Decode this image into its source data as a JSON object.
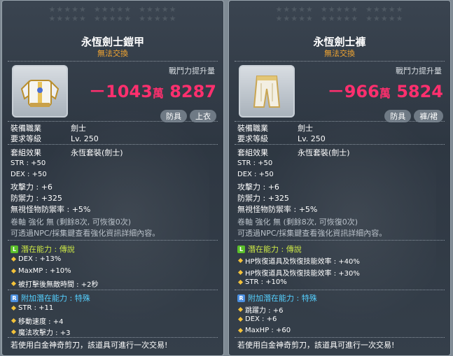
{
  "left": {
    "stars": [
      "★★★★★",
      "★★★★★",
      "★★★★★",
      "★★★★★",
      "★★★★★",
      "★★★★★"
    ],
    "title": "永恆劍士鎧甲",
    "trade": "無法交換",
    "cp_label": "戰鬥力提升量",
    "cp_main": "－1043",
    "cp_man": "萬",
    "cp_tail": "8287",
    "tags": [
      "防具",
      "上衣"
    ],
    "job_label": "裝備職業",
    "job_value": "劍士",
    "lvl_label": "要求等級",
    "lvl_value": "Lv. 250",
    "set_label": "套組效果",
    "set_value": "永恆套裝(劍士)",
    "stats": [
      "STR : +50",
      "DEX : +50",
      "攻擊力 : +6",
      "防禦力 : +325",
      "無視怪物防禦率 : +5%"
    ],
    "scroll_line": "卷軸 強化 無 (剩餘8次, 可恢復0次)",
    "npc_line": "可透過NPC/採集鍵查看強化資訊詳細內容。",
    "potential_title": "潛在能力 : 傳說",
    "potential": [
      "DEX : +13%",
      "MaxMP : +10%",
      "被打擊後無敵時間 : +2秒"
    ],
    "add_title": "附加潛在能力 : 特殊",
    "add_potential": [
      "STR : +11",
      "移動速度 : +4",
      "魔法攻擊力 : +3"
    ],
    "footer": "若使用白金神奇剪刀，該道具可進行一次交易!"
  },
  "right": {
    "stars": [
      "★★★★★",
      "★★★★★",
      "★★★★★",
      "★★★★★",
      "★★★★★",
      "★★★★★"
    ],
    "title": "永恆劍士褲",
    "trade": "無法交換",
    "cp_label": "戰鬥力提升量",
    "cp_main": "－966",
    "cp_man": "萬",
    "cp_tail": "5824",
    "tags": [
      "防具",
      "褲/裙"
    ],
    "job_label": "裝備職業",
    "job_value": "劍士",
    "lvl_label": "要求等級",
    "lvl_value": "Lv. 250",
    "set_label": "套組效果",
    "set_value": "永恆套裝(劍士)",
    "stats": [
      "STR : +50",
      "DEX : +50",
      "攻擊力 : +6",
      "防禦力 : +325",
      "無視怪物防禦率 : +5%"
    ],
    "scroll_line": "卷軸 強化 無 (剩餘8次, 可恢復0次)",
    "npc_line": "可透過NPC/採集鍵查看強化資訊詳細內容。",
    "potential_title": "潛在能力 : 傳說",
    "potential": [
      "HP恢復道具及恢復技能效率 : +40%",
      "HP恢復道具及恢復技能效率 : +30%",
      "STR : +10%"
    ],
    "add_title": "附加潛在能力 : 特殊",
    "add_potential": [
      "跳躍力 : +6",
      "DEX : +6",
      "MaxHP : +60"
    ],
    "footer": "若使用白金神奇剪刀，該道具可進行一次交易!"
  },
  "colors": {
    "cp": "#ff2f6e",
    "trade": "#f2a531",
    "legend": "#cde946",
    "rare": "#55d0ff"
  }
}
